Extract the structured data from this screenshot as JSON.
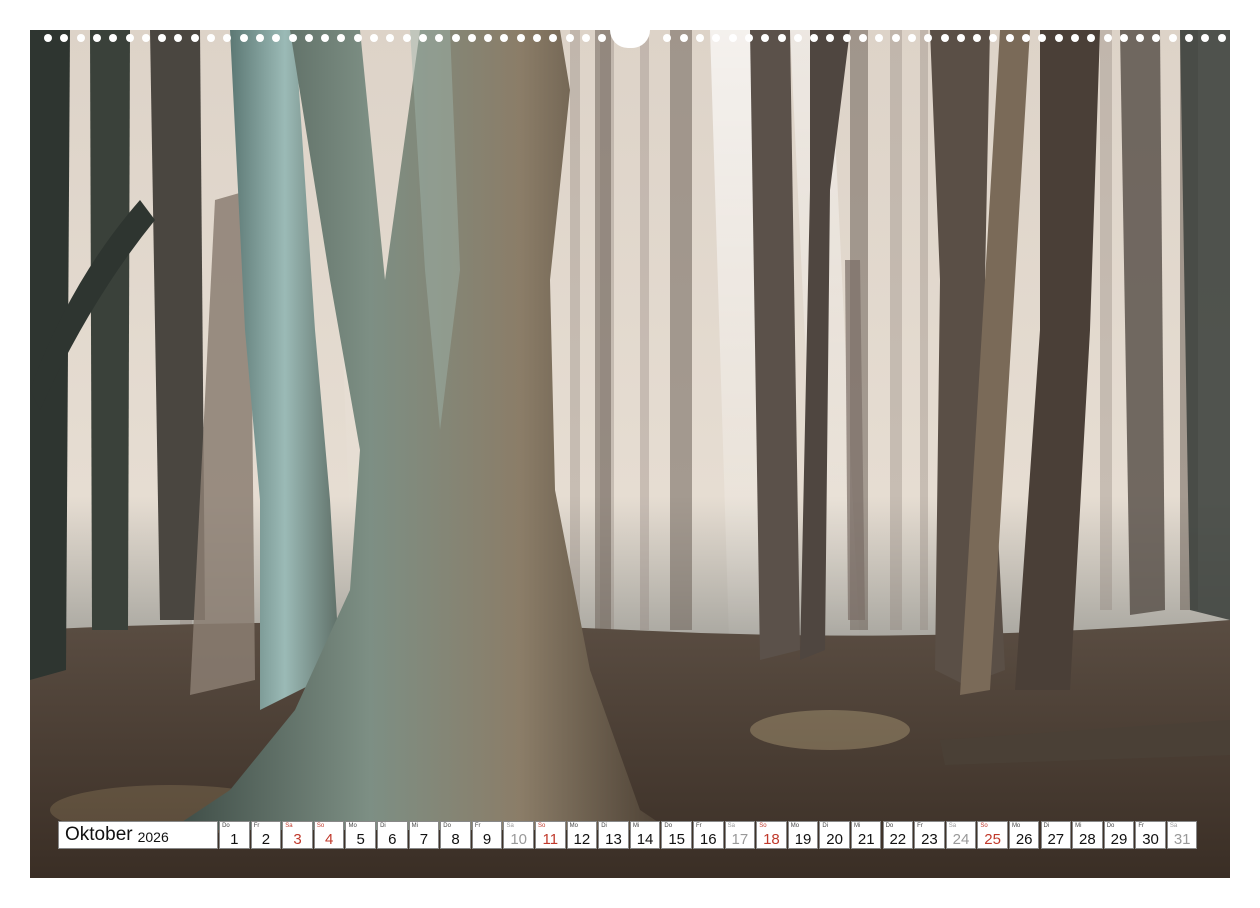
{
  "calendar": {
    "month": "Oktober",
    "year": "2026",
    "days": [
      {
        "wd": "Do",
        "n": "1",
        "t": "w"
      },
      {
        "wd": "Fr",
        "n": "2",
        "t": "w"
      },
      {
        "wd": "Sa",
        "n": "3",
        "t": "holiday"
      },
      {
        "wd": "So",
        "n": "4",
        "t": "sun"
      },
      {
        "wd": "Mo",
        "n": "5",
        "t": "w"
      },
      {
        "wd": "Di",
        "n": "6",
        "t": "w"
      },
      {
        "wd": "Mi",
        "n": "7",
        "t": "w"
      },
      {
        "wd": "Do",
        "n": "8",
        "t": "w"
      },
      {
        "wd": "Fr",
        "n": "9",
        "t": "w"
      },
      {
        "wd": "Sa",
        "n": "10",
        "t": "sat"
      },
      {
        "wd": "So",
        "n": "11",
        "t": "sun"
      },
      {
        "wd": "Mo",
        "n": "12",
        "t": "w"
      },
      {
        "wd": "Di",
        "n": "13",
        "t": "w"
      },
      {
        "wd": "Mi",
        "n": "14",
        "t": "w"
      },
      {
        "wd": "Do",
        "n": "15",
        "t": "w"
      },
      {
        "wd": "Fr",
        "n": "16",
        "t": "w"
      },
      {
        "wd": "Sa",
        "n": "17",
        "t": "sat"
      },
      {
        "wd": "So",
        "n": "18",
        "t": "sun"
      },
      {
        "wd": "Mo",
        "n": "19",
        "t": "w"
      },
      {
        "wd": "Di",
        "n": "20",
        "t": "w"
      },
      {
        "wd": "Mi",
        "n": "21",
        "t": "w"
      },
      {
        "wd": "Do",
        "n": "22",
        "t": "w"
      },
      {
        "wd": "Fr",
        "n": "23",
        "t": "w"
      },
      {
        "wd": "Sa",
        "n": "24",
        "t": "sat"
      },
      {
        "wd": "So",
        "n": "25",
        "t": "sun"
      },
      {
        "wd": "Mo",
        "n": "26",
        "t": "w"
      },
      {
        "wd": "Di",
        "n": "27",
        "t": "w"
      },
      {
        "wd": "Mi",
        "n": "28",
        "t": "w"
      },
      {
        "wd": "Do",
        "n": "29",
        "t": "w"
      },
      {
        "wd": "Fr",
        "n": "30",
        "t": "w"
      },
      {
        "wd": "Sa",
        "n": "31",
        "t": "sat"
      }
    ]
  },
  "colors": {
    "sunday": "#c0392b",
    "saturday": "#999999",
    "photo_mist": "#e8dcd2",
    "photo_ground": "#4a3a2e",
    "trunk_teal": "#7a9a96"
  }
}
